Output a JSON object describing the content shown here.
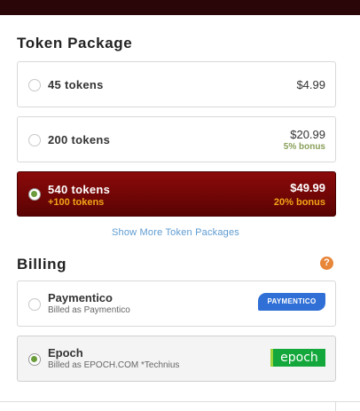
{
  "token_section": {
    "title": "Token Package",
    "packages": [
      {
        "label": "45 tokens",
        "price": "$4.99",
        "bonus": "",
        "extra": "",
        "selected": false
      },
      {
        "label": "200 tokens",
        "price": "$20.99",
        "bonus": "5% bonus",
        "extra": "",
        "selected": false
      },
      {
        "label": "540 tokens",
        "price": "$49.99",
        "bonus": "20% bonus",
        "extra": "+100 tokens",
        "selected": true
      }
    ],
    "show_more": "Show More Token Packages"
  },
  "billing_section": {
    "title": "Billing",
    "help_icon": "?",
    "methods": [
      {
        "name": "Paymentico",
        "subtitle": "Billed as Paymentico",
        "logo_text": "PAYMENTICO",
        "selected": false
      },
      {
        "name": "Epoch",
        "subtitle": "Billed as EPOCH.COM *Technius",
        "logo_text": "epoch",
        "selected": true
      }
    ]
  },
  "colors": {
    "selected_package_bg": "#7a0707",
    "bonus_green": "#8aa05a",
    "bonus_orange": "#f2a418",
    "link_blue": "#5e9bd1",
    "radio_green": "#6b9c3b"
  }
}
